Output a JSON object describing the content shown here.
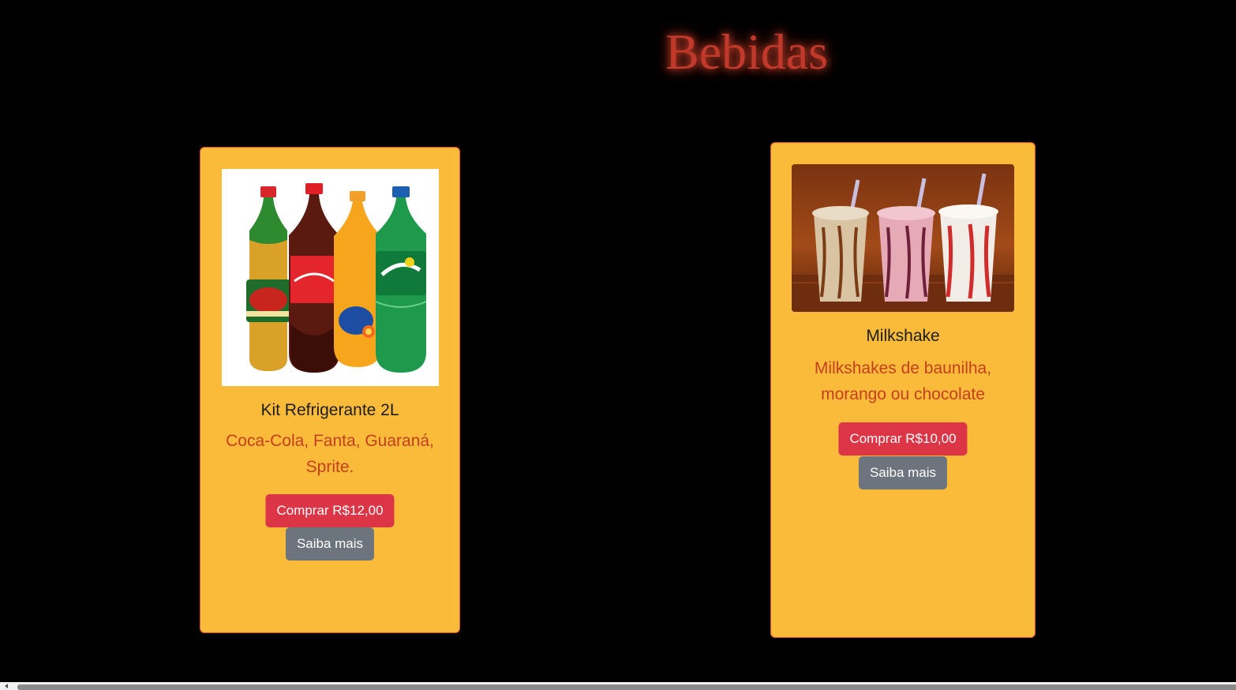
{
  "page": {
    "title": "Bebidas"
  },
  "products": [
    {
      "name": "Kit Refrigerante 2L",
      "description": "Coca-Cola, Fanta, Guaraná, Sprite.",
      "buy_label": "Comprar R$12,00",
      "more_label": "Saiba mais",
      "image_icon": "soda-bottles-image"
    },
    {
      "name": "Milkshake",
      "description": "Milkshakes de baunilha, morango ou chocolate",
      "buy_label": "Comprar R$10,00",
      "more_label": "Saiba mais",
      "image_icon": "milkshakes-image"
    }
  ],
  "colors": {
    "background": "#000000",
    "card_background": "#fbbb3a",
    "title": "#c0392b",
    "description": "#c43f1f",
    "buy_button": "#dc3545",
    "more_button": "#6c757d"
  }
}
